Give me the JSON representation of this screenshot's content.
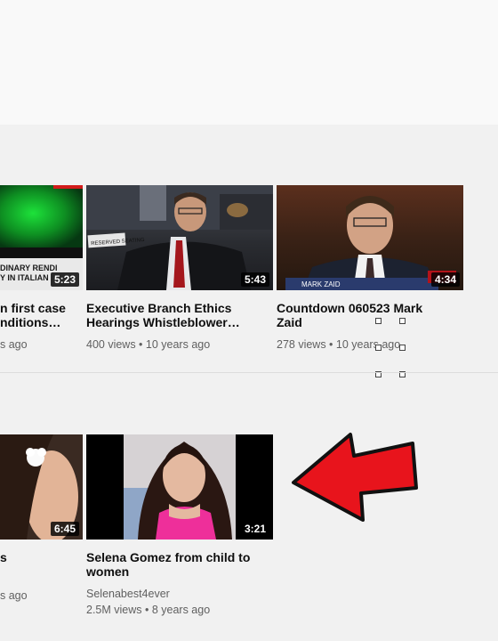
{
  "videos_row1": [
    {
      "title_line1": "n first case",
      "title_line2": "nditions…",
      "meta": "s ago",
      "duration": "5:23",
      "caption_line1": "DINARY RENDI",
      "caption_line2": "Y IN ITALIAN"
    },
    {
      "title_line1": "Executive Branch Ethics",
      "title_line2": "Hearings Whistleblower…",
      "meta": "400 views • 10 years ago",
      "duration": "5:43",
      "sign": "RESERVED SEATING"
    },
    {
      "title_line1": "Countdown 060523 Mark",
      "title_line2": "Zaid",
      "meta": "278 views • 10 years ago",
      "duration": "4:34",
      "caption": "MARK ZAID"
    }
  ],
  "videos_row2": [
    {
      "title_line1": "s",
      "meta": "s ago",
      "duration": "6:45"
    },
    {
      "title_line1": "Selena Gomez from child to",
      "title_line2": "women",
      "channel": "Selenabest4ever",
      "meta": "2.5M views • 8 years ago",
      "duration": "3:21"
    }
  ],
  "colors": {
    "arrow_red": "#e8141c",
    "page_bg": "#f1f1f1"
  }
}
